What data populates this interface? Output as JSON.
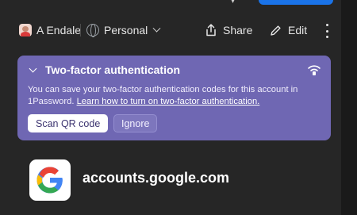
{
  "toolbar": {
    "user_vault": "A Endale",
    "personal_vault": "Personal",
    "share_label": "Share",
    "edit_label": "Edit"
  },
  "banner": {
    "title": "Two-factor authentication",
    "body_text": "You can save your two-factor authentication codes for this account in 1Password.",
    "link_text": "Learn how to turn on two-factor authentication.",
    "scan_button": "Scan QR code",
    "ignore_button": "Ignore",
    "color": "#6f67b3"
  },
  "item": {
    "title": "accounts.google.com",
    "logo_icon": "google-logo-icon"
  },
  "colors": {
    "background": "#262626",
    "accent": "#1a73e8"
  }
}
